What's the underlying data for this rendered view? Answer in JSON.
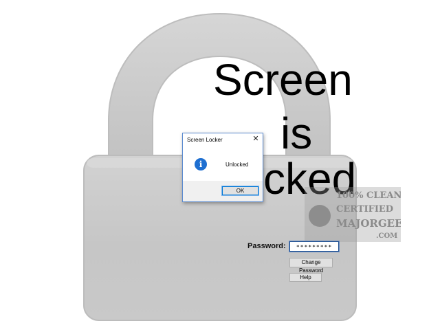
{
  "lock_screen": {
    "heading_lines": [
      "Screen",
      "is",
      "cked"
    ],
    "password_label": "Password:",
    "password_value": "*********",
    "change_password_label": "Change Password",
    "help_label": "Help"
  },
  "dialog": {
    "title": "Screen Locker",
    "close_glyph": "✕",
    "icon": "info-icon",
    "icon_glyph": "i",
    "message": "Unlocked",
    "ok_label": "OK"
  },
  "watermark": {
    "line1": "100% CLEAN",
    "line2": "CERTIFIED",
    "line3": "MAJORGEEKS",
    "line4": ".COM"
  },
  "colors": {
    "padlock_body": "#c8c8c8",
    "dialog_border": "#5a8ad0",
    "info_icon": "#1e6fd1",
    "ok_focus": "#0078d7"
  }
}
